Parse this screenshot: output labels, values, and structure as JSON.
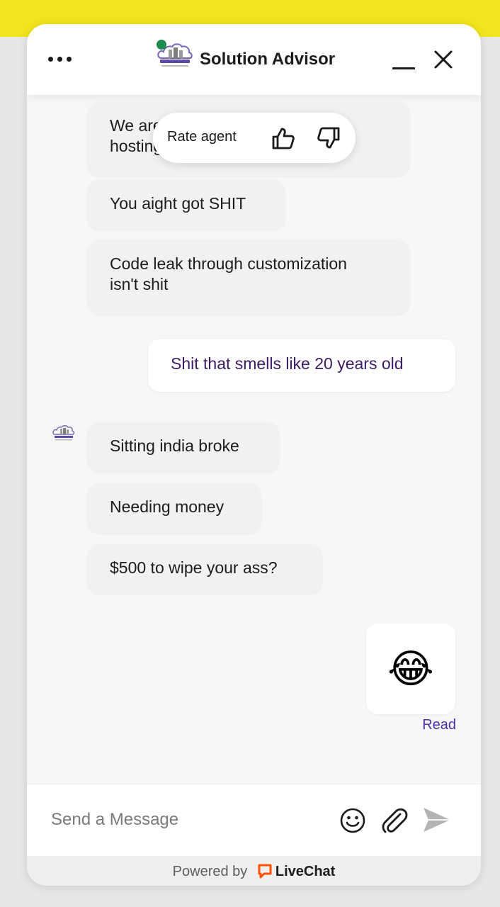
{
  "header": {
    "title": "Solution Advisor",
    "logo_name": "cloudfitters",
    "status_color": "#1e8b4f"
  },
  "rating": {
    "label": "Rate agent"
  },
  "messages": [
    {
      "from": "agent",
      "text_line1": "We are",
      "text_line2": "hosting"
    },
    {
      "from": "agent",
      "text": "You aight got SHIT"
    },
    {
      "from": "agent",
      "text_line1": "Code leak through customization",
      "text_line2": "isn't shit"
    },
    {
      "from": "visitor",
      "text": "Shit that smells like 20 years old"
    },
    {
      "from": "agent",
      "text": "Sitting india broke"
    },
    {
      "from": "agent",
      "text": "Needing money"
    },
    {
      "from": "agent",
      "text": "$500 to wipe your ass?"
    },
    {
      "from": "visitor",
      "text": "😂"
    }
  ],
  "read_status": "Read",
  "composer": {
    "placeholder": "Send a Message"
  },
  "footer": {
    "powered_by": "Powered by",
    "brand": "LiveChat",
    "brand_color": "#ff5100"
  },
  "colors": {
    "top_bar": "#f1e51d",
    "visitor_text": "#3c1a65",
    "read_status": "#4b2fa6"
  }
}
